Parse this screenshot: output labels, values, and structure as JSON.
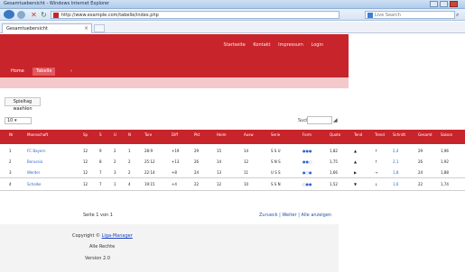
{
  "window": {
    "title": "Gesamtuebersicht - Windows Internet Explorer"
  },
  "browser": {
    "url": "http://www.example.com/tabelle/index.php",
    "search_placeholder": "Live Search",
    "tab_label": "Gesamtuebersicht",
    "icons": [
      "back-icon",
      "forward-icon",
      "stop-icon",
      "refresh-icon",
      "search-icon"
    ]
  },
  "site": {
    "top_menu": [
      "Startseite",
      "Kontakt",
      "Impressum",
      "Login"
    ],
    "main_nav": {
      "home": "Home",
      "active": "Tabelle",
      "more": "›"
    },
    "section_button": "Spieltag waehlen",
    "show_label": "10 ▾",
    "filter_label": "Suche:",
    "colors": {
      "brand": "#c8242b",
      "subbar": "#f3c9cb"
    }
  },
  "table": {
    "headers": [
      "Nr",
      "Mannschaft",
      "Sp",
      "S",
      "U",
      "N",
      "Tore",
      "Diff",
      "Pkt",
      "Heim",
      "Ausw",
      "Serie",
      "Form",
      "Quote",
      "Tend",
      "Trend",
      "Schnitt",
      "Gesamt",
      "Saison"
    ],
    "rows": [
      [
        "1",
        "FC Bayern",
        "12",
        "9",
        "2",
        "1",
        "28:9",
        "+19",
        "29",
        "15",
        "14",
        "S S U",
        "●●●",
        "1,82",
        "▲",
        "↑",
        "2,4",
        "29",
        "1,96"
      ],
      [
        "2",
        "Borussia",
        "12",
        "8",
        "2",
        "2",
        "25:12",
        "+13",
        "26",
        "14",
        "12",
        "S N S",
        "●●○",
        "1,75",
        "▲",
        "↑",
        "2,1",
        "26",
        "1,92"
      ],
      [
        "3",
        "Werder",
        "12",
        "7",
        "3",
        "2",
        "22:14",
        "+8",
        "24",
        "13",
        "11",
        "U S S",
        "●○●",
        "1,66",
        "▶",
        "→",
        "1,8",
        "24",
        "1,88"
      ],
      [
        "4",
        "Schalke",
        "12",
        "7",
        "1",
        "4",
        "19:15",
        "+4",
        "22",
        "12",
        "10",
        "S S N",
        "○●●",
        "1,52",
        "▼",
        "↓",
        "1,6",
        "22",
        "1,74"
      ]
    ]
  },
  "footer": {
    "left": "Seite 1 von 1",
    "right": "Zurueck | Weiter | Alle anzeigen",
    "copyright_prefix": "Copyright © ",
    "copyright_link": "Liga-Manager",
    "line2": "Alle Rechte",
    "line3": "Version 2.0"
  }
}
